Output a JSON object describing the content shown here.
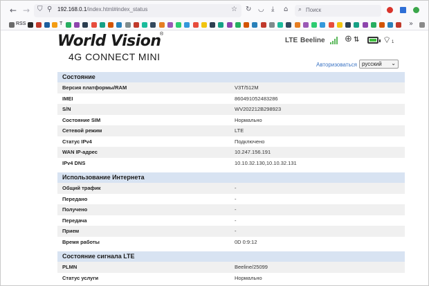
{
  "browser": {
    "url_host": "192.168.0.1",
    "url_path": "/index.html#index_status",
    "search_placeholder": "Поиск"
  },
  "bookmarks": {
    "rss_label": "RSS",
    "t_label": "T"
  },
  "header": {
    "logo_title": "World Vision",
    "logo_registered": "®",
    "logo_subtitle": "4G CONNECT MINI",
    "network_type": "LTE",
    "operator": "Beeline"
  },
  "topbar": {
    "login_label": "Авторизоваться",
    "language": "русский"
  },
  "status": {
    "title": "Состояние",
    "rows": [
      {
        "label": "Версия платформы/RAM",
        "value": "V3T/512M"
      },
      {
        "label": "IMEI",
        "value": "860491052483286"
      },
      {
        "label": "S/N",
        "value": "WV202212B298923"
      },
      {
        "label": "Состояние SIM",
        "value": "Нормально"
      },
      {
        "label": "Сетевой режим",
        "value": "LTE"
      },
      {
        "label": "Статус IPv4",
        "value": "Подключено"
      },
      {
        "label": "WAN IP-адрес",
        "value": "10.247.156.191"
      },
      {
        "label": "IPv4 DNS",
        "value": "10.10.32.130,10.10.32.131"
      }
    ]
  },
  "internet": {
    "title": "Использование Интернета",
    "rows": [
      {
        "label": "Общий трафик",
        "value": "-"
      },
      {
        "label": "Передано",
        "value": "-"
      },
      {
        "label": "Получено",
        "value": "-"
      },
      {
        "label": "Передача",
        "value": "-"
      },
      {
        "label": "Прием",
        "value": "-"
      },
      {
        "label": "Время работы",
        "value": "0D   0:9:12"
      }
    ]
  },
  "lte": {
    "title": "Состояние сигнала LTE",
    "rows": [
      {
        "label": "PLMN",
        "value": "Beeline/25099"
      },
      {
        "label": "Статус услуги",
        "value": "Нормально"
      }
    ]
  },
  "colors": {
    "section_header": "#d8e3f2",
    "row_alt": "#f0f0f0",
    "link": "#3a73c4",
    "signal": "#5cb85c",
    "battery": "#3fbf3f"
  }
}
